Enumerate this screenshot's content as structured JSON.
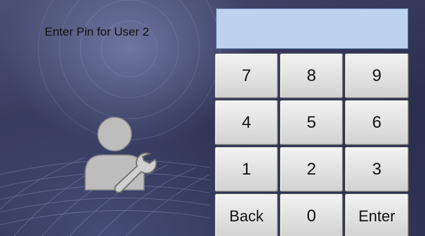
{
  "prompt_label": "Enter Pin for User 2",
  "pin_display": {
    "value": "",
    "background_color": "#bcd3f0"
  },
  "user_icon": {
    "name": "user-settings-icon",
    "color": "#bdbdbd"
  },
  "keypad": {
    "keys": [
      "7",
      "8",
      "9",
      "4",
      "5",
      "6",
      "1",
      "2",
      "3",
      "Back",
      "0",
      "Enter"
    ]
  }
}
